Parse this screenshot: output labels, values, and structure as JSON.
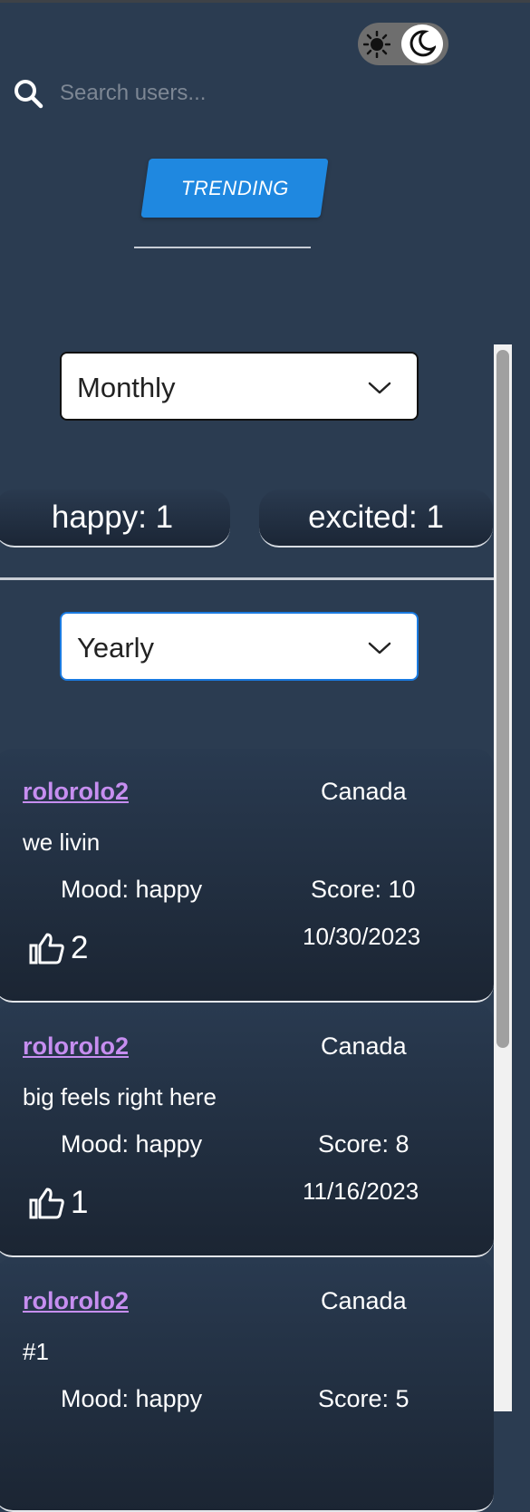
{
  "theme_toggle": {
    "sun_icon": "sun-icon",
    "moon_icon": "moon-icon",
    "mode": "dark"
  },
  "search": {
    "icon": "search-icon",
    "placeholder": "Search users..."
  },
  "trending": {
    "label": "TRENDING"
  },
  "filters": {
    "monthly": "Monthly",
    "yearly": "Yearly"
  },
  "moods": [
    {
      "label": "happy: 1"
    },
    {
      "label": "excited: 1"
    }
  ],
  "posts": [
    {
      "user": "rolorolo2",
      "country": "Canada",
      "content": "we livin",
      "mood": "Mood: happy",
      "score": "Score: 10",
      "likes": "2",
      "date": "10/30/2023"
    },
    {
      "user": "rolorolo2",
      "country": "Canada",
      "content": "big feels right here",
      "mood": "Mood: happy",
      "score": "Score: 8",
      "likes": "1",
      "date": "11/16/2023"
    },
    {
      "user": "rolorolo2",
      "country": "Canada",
      "content": "#1",
      "mood": "Mood: happy",
      "score": "Score: 5",
      "likes": "",
      "date": ""
    }
  ],
  "colors": {
    "background": "#2b3c51",
    "accent": "#1f88e0",
    "username": "#c68ef0"
  }
}
